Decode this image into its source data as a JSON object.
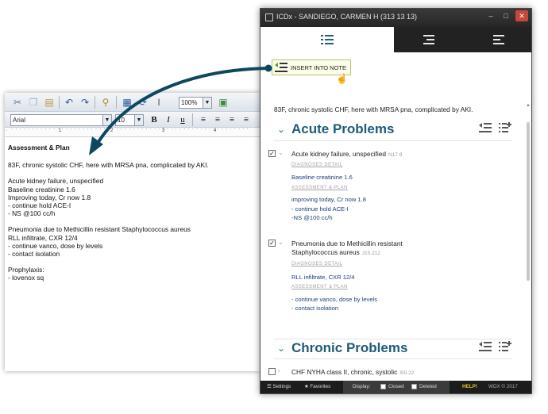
{
  "editor": {
    "toolbar": {
      "zoom": "100%",
      "font": "Arial",
      "font_size": "10",
      "bold": "B",
      "italic": "I",
      "underline": "u"
    },
    "ruler": [
      "1",
      "2",
      "3",
      "4"
    ],
    "document": {
      "heading": "Assessment & Plan",
      "paragraphs": [
        [
          "83F, chronic systolic CHF, here with MRSA pna, complicated by AKI."
        ],
        [
          "Acute kidney failure, unspecified",
          "Baseline creatinine 1.6",
          "Improving today, Cr now 1.8",
          "- continue hold ACE-I",
          "- NS @100 cc/h"
        ],
        [
          "Pneumonia due to Methicillin resistant Staphylococcus aureus",
          "RLL infiltrate, CXR 12/4",
          "- continue vanco, dose by levels",
          "- contact isolation"
        ],
        [
          "Prophylaxis:",
          "- lovenox sq"
        ]
      ]
    }
  },
  "panel": {
    "title": "ICDx - SANDIEGO, CARMEN H (313 13 13)",
    "window_buttons": {
      "minimize": "–",
      "maximize": "□",
      "close": "✕"
    },
    "tabs": [
      "list-icon",
      "indent-icon",
      "align-left-icon"
    ],
    "insert_button": "INSERT INTO NOTE",
    "summary": "83F, chronic systolic CHF, here with MRSA pna, complicated by AKI.",
    "sections": [
      {
        "title": "Acute Problems",
        "problems": [
          {
            "checked": true,
            "check_glyph": "✓",
            "name": "Acute kidney failure, unspecified",
            "code": "N17.9",
            "diagnoses_label": "DIAGNOSES DETAIL",
            "diagnoses": [
              "Baseline creatinine 1.6"
            ],
            "plan_label": "ASSESSMENT & PLAN",
            "plan": [
              "improving today, Cr now 1.8",
              "- continue hold ACE-I",
              "-NS @100 cc/h"
            ]
          },
          {
            "checked": true,
            "check_glyph": "✓",
            "name": "Pneumonia due to Methicillin resistant",
            "name2": "Staphylococcus aureus",
            "code": "J15.212",
            "diagnoses_label": "DIAGNOSES DETAIL",
            "diagnoses": [
              "RLL infiltrate, CXR 12/4"
            ],
            "plan_label": "ASSESSMENT & PLAN",
            "plan": [
              "- continue vanco, dose by levels",
              "- contact isolation"
            ]
          }
        ]
      },
      {
        "title": "Chronic Problems",
        "problems": [
          {
            "checked": false,
            "name": "CHF NYHA class II, chronic, systolic",
            "code": "I50.22"
          }
        ]
      }
    ],
    "footer": {
      "settings": "Settings",
      "favorites": "Favorites",
      "display": "Display:",
      "closed": "Closed",
      "deleted": "Deleted",
      "help": "HELP!",
      "copyright": "WDX © 2017"
    }
  },
  "colors": {
    "section_title": "#1f5c78",
    "detail_text": "#1e3f7a",
    "arrow": "#0d4760",
    "insert_border": "#b9c46a"
  }
}
